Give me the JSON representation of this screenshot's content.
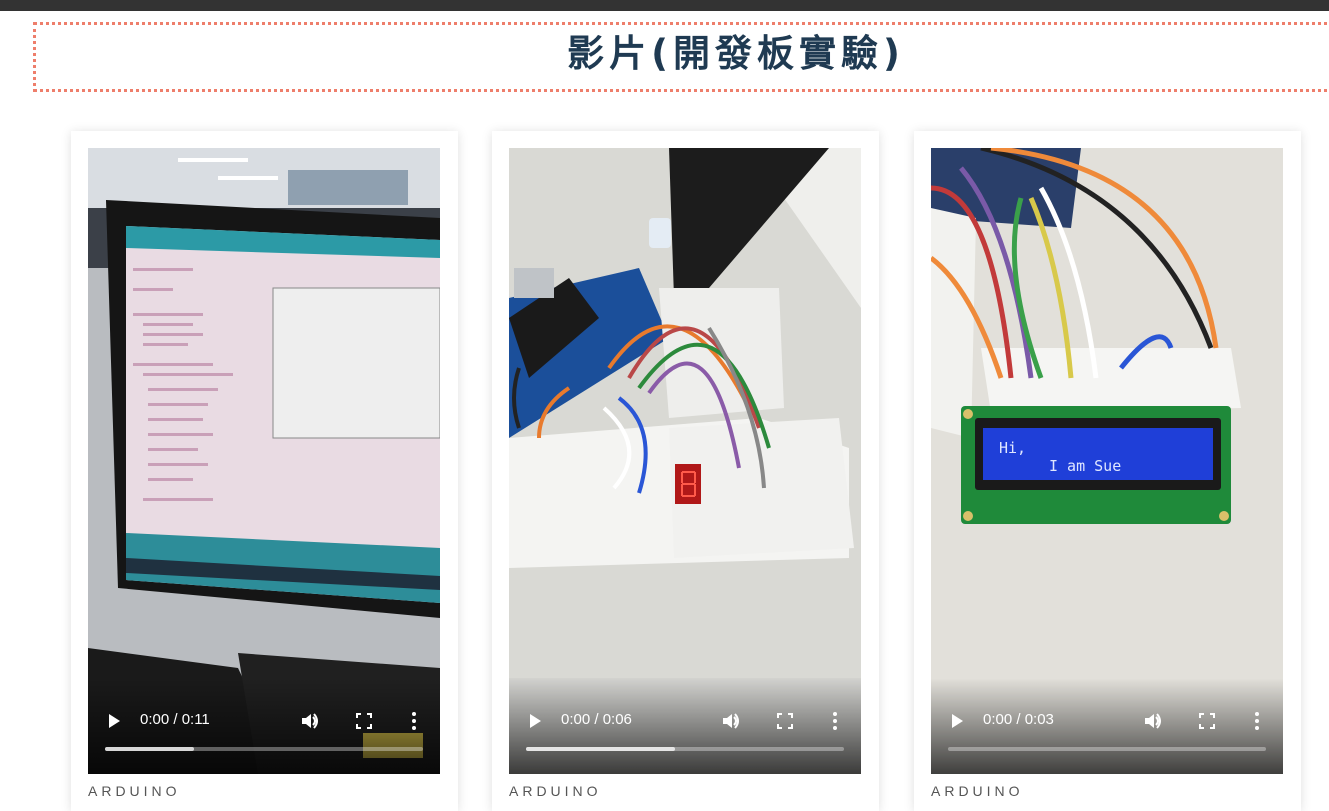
{
  "header": {
    "title": "影片(開發板實驗)"
  },
  "videos": [
    {
      "time": "0:00 / 0:11",
      "progress": 0.28,
      "category": "ARDUINO",
      "scene": "monitor with Arduino IDE code"
    },
    {
      "time": "0:00 / 0:06",
      "progress": 0.47,
      "category": "ARDUINO",
      "scene": "Arduino with seven-segment display on breadboard"
    },
    {
      "time": "0:00 / 0:03",
      "progress": 0.0,
      "category": "ARDUINO",
      "scene": "Arduino with LCD on breadboard",
      "lcd_line1": "Hi,",
      "lcd_line2": "I am Sue"
    }
  ],
  "colors": {
    "accent_dotted_border": "#ee7e6b",
    "title": "#1f3a52",
    "topbar": "#333333",
    "lcd": "#1f3fd8"
  },
  "icons": [
    "play-icon",
    "volume-icon",
    "fullscreen-icon",
    "more-options-icon"
  ]
}
